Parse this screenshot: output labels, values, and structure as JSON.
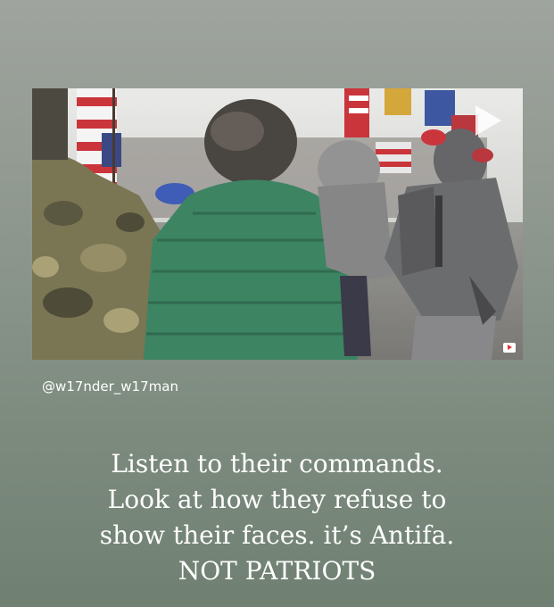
{
  "video": {
    "play_icon": "play-icon",
    "badge_icon": "video-badge-icon"
  },
  "attribution": "@w17nder_w17man",
  "caption": {
    "lines": [
      "Listen to their commands.",
      "Look at how they refuse to",
      "show their faces. it’s Antifa.",
      "NOT PATRIOTS"
    ]
  }
}
